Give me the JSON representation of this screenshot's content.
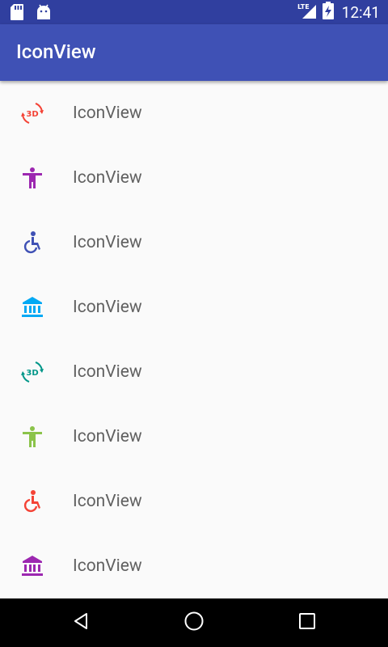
{
  "status_bar": {
    "time": "12:41",
    "network": "LTE"
  },
  "app_bar": {
    "title": "IconView"
  },
  "list": {
    "items": [
      {
        "label": "IconView",
        "icon": "3d-rotation-icon",
        "color": "#f44336"
      },
      {
        "label": "IconView",
        "icon": "accessibility-icon",
        "color": "#9c27b0"
      },
      {
        "label": "IconView",
        "icon": "accessible-icon",
        "color": "#3f51b5"
      },
      {
        "label": "IconView",
        "icon": "account-balance-icon",
        "color": "#03a9f4"
      },
      {
        "label": "IconView",
        "icon": "3d-rotation-icon",
        "color": "#009688"
      },
      {
        "label": "IconView",
        "icon": "accessibility-icon",
        "color": "#8bc34a"
      },
      {
        "label": "IconView",
        "icon": "accessible-icon",
        "color": "#f44336"
      },
      {
        "label": "IconView",
        "icon": "account-balance-icon",
        "color": "#9c27b0"
      }
    ]
  },
  "colors": {
    "status_bar": "#303f9f",
    "app_bar": "#3f51b5",
    "background": "#fafafa",
    "label": "#616161"
  }
}
